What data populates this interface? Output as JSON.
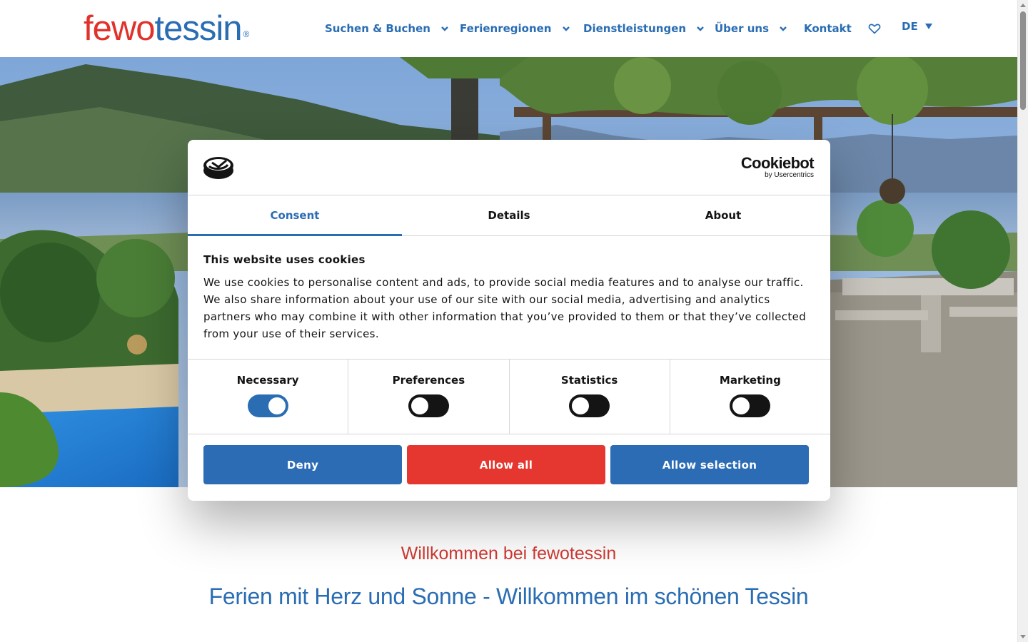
{
  "header": {
    "logo": {
      "part1": "fewo",
      "part2": "tessin",
      "reg": "®"
    },
    "nav": [
      {
        "label": "Suchen & Buchen",
        "has_dropdown": true
      },
      {
        "label": "Ferienregionen",
        "has_dropdown": true
      },
      {
        "label": "Dienstleistungen",
        "has_dropdown": true
      },
      {
        "label": "Über uns",
        "has_dropdown": true
      },
      {
        "label": "Kontakt",
        "has_dropdown": false
      }
    ],
    "favorites_icon": "heart-icon",
    "language": "DE"
  },
  "cookie_dialog": {
    "brand_name": "Cookiebot",
    "brand_sub": "by Usercentrics",
    "tabs": [
      {
        "label": "Consent",
        "active": true
      },
      {
        "label": "Details",
        "active": false
      },
      {
        "label": "About",
        "active": false
      }
    ],
    "heading": "This website uses cookies",
    "body": "We use cookies to personalise content and ads, to provide social media features and to analyse our traffic. We also share information about your use of our site with our social media, advertising and analytics partners who may combine it with other information that you’ve provided to them or that they’ve collected from your use of their services.",
    "categories": [
      {
        "label": "Necessary",
        "enabled": true
      },
      {
        "label": "Preferences",
        "enabled": false
      },
      {
        "label": "Statistics",
        "enabled": false
      },
      {
        "label": "Marketing",
        "enabled": false
      }
    ],
    "buttons": {
      "deny": "Deny",
      "allow_all": "Allow all",
      "allow_selection": "Allow selection"
    }
  },
  "main": {
    "welcome": "Willkommen bei fewotessin",
    "tagline": "Ferien mit Herz und Sonne - Willkommen im schönen Tessin"
  },
  "colors": {
    "brand_blue": "#2a6db3",
    "brand_red": "#e0322b",
    "allow_all_red": "#e5372f"
  }
}
